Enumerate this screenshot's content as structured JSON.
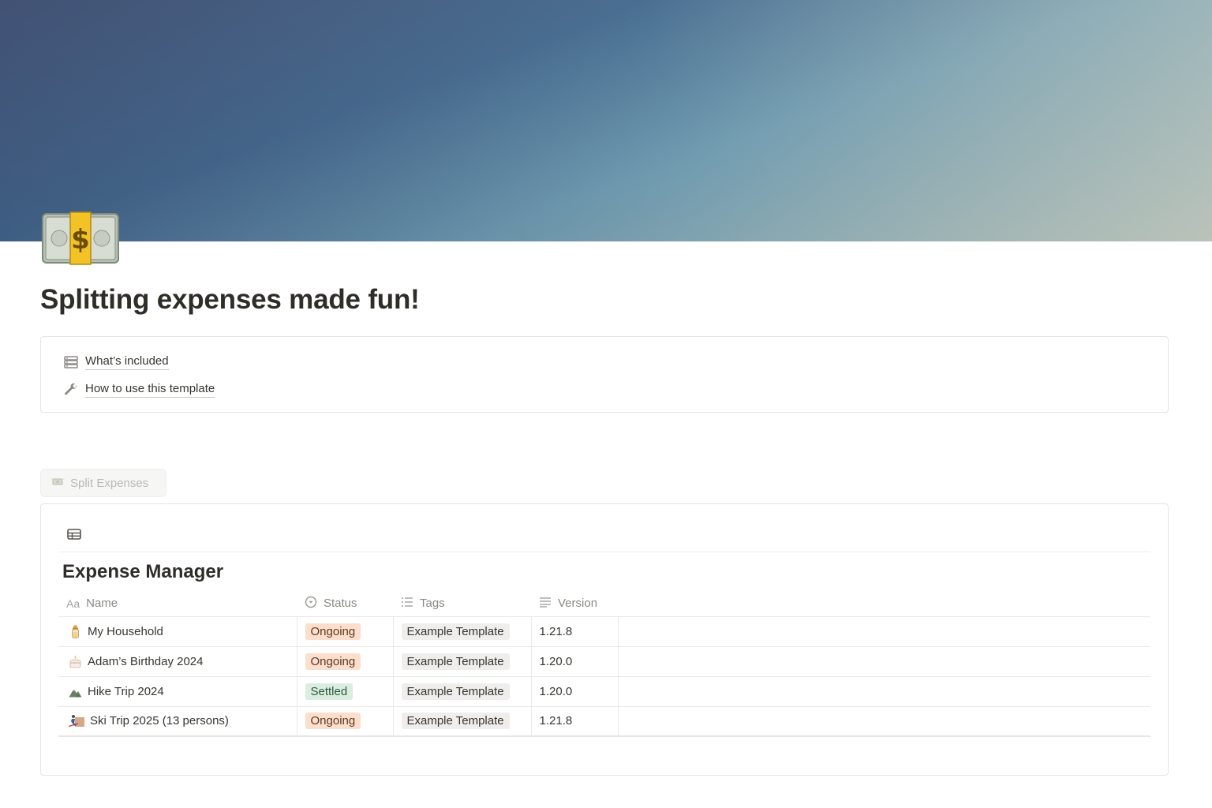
{
  "page": {
    "title": "Splitting expenses made fun!",
    "icon": "money-dollar-bill-icon"
  },
  "toc": {
    "items": [
      {
        "label": "What’s included",
        "icon": "database-stack-icon"
      },
      {
        "label": "How to use this template",
        "icon": "wrench-icon"
      }
    ]
  },
  "button": {
    "label": "Split Expenses",
    "icon": "money-wings-icon"
  },
  "database": {
    "title": "Expense Manager",
    "view_icon": "table-icon",
    "columns": [
      {
        "label": "Name",
        "icon": "text-aa-icon"
      },
      {
        "label": "Status",
        "icon": "status-circle-icon"
      },
      {
        "label": "Tags",
        "icon": "list-icon"
      },
      {
        "label": "Version",
        "icon": "text-lines-icon"
      }
    ],
    "rows": [
      {
        "name": "My Household",
        "icon": "baby-bottle-icon",
        "status": "Ongoing",
        "tag": "Example Template",
        "version": "1.21.8"
      },
      {
        "name": "Adam’s Birthday 2024",
        "icon": "birthday-cake-icon",
        "status": "Ongoing",
        "tag": "Example Template",
        "version": "1.20.0"
      },
      {
        "name": "Hike Trip 2024",
        "icon": "mountain-icon",
        "status": "Settled",
        "tag": "Example Template",
        "version": "1.20.0"
      },
      {
        "name": "Ski Trip 2025 (13 persons)",
        "icon": "skier-icon",
        "status": "Ongoing",
        "tag": "Example Template",
        "version": "1.21.8"
      }
    ]
  },
  "colors": {
    "ongoing_bg": "#fbdecb",
    "settled_bg": "#dbece0",
    "tag_bg": "#efeeec"
  }
}
